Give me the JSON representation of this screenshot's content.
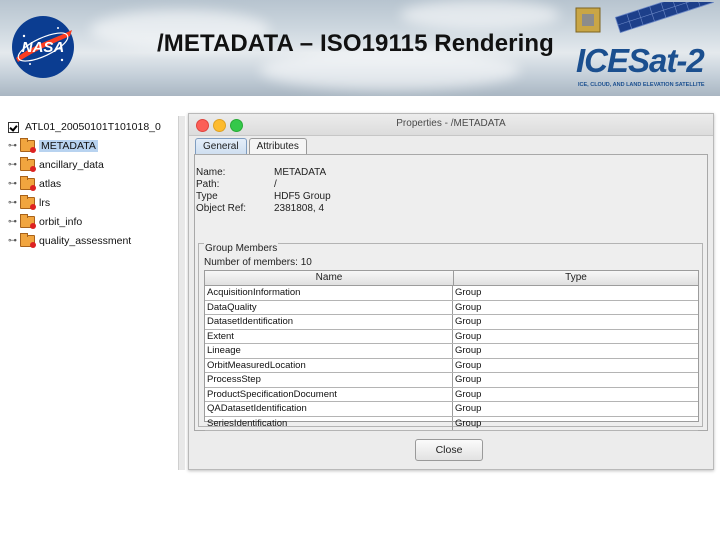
{
  "slide": {
    "title": "/METADATA – ISO19115 Rendering"
  },
  "logos": {
    "nasa_text": "NASA",
    "icesat_text": "ICESat-2",
    "icesat_tagline": "ICE, CLOUD, AND LAND ELEVATION SATELLITE"
  },
  "tree": {
    "root_label": "ATL01_20050101T101018_0",
    "items": [
      {
        "label": "METADATA",
        "selected": true
      },
      {
        "label": "ancillary_data",
        "selected": false
      },
      {
        "label": "atlas",
        "selected": false
      },
      {
        "label": "lrs",
        "selected": false
      },
      {
        "label": "orbit_info",
        "selected": false
      },
      {
        "label": "quality_assessment",
        "selected": false
      }
    ]
  },
  "window": {
    "title": "Properties - /METADATA",
    "tabs": [
      {
        "label": "General",
        "active": true
      },
      {
        "label": "Attributes",
        "active": false
      }
    ],
    "info": [
      {
        "key": "Name:",
        "value": "METADATA"
      },
      {
        "key": "Path:",
        "value": "/"
      },
      {
        "key": "Type",
        "value": "HDF5 Group"
      },
      {
        "key": "Object Ref:",
        "value": "2381808, 4"
      }
    ],
    "group_members": {
      "title": "Group Members",
      "count_label": "Number of members: 10",
      "columns": [
        "Name",
        "Type"
      ],
      "rows": [
        [
          "AcquisitionInformation",
          "Group"
        ],
        [
          "DataQuality",
          "Group"
        ],
        [
          "DatasetIdentification",
          "Group"
        ],
        [
          "Extent",
          "Group"
        ],
        [
          "Lineage",
          "Group"
        ],
        [
          "OrbitMeasuredLocation",
          "Group"
        ],
        [
          "ProcessStep",
          "Group"
        ],
        [
          "ProductSpecificationDocument",
          "Group"
        ],
        [
          "QADatasetIdentification",
          "Group"
        ],
        [
          "SeriesIdentification",
          "Group"
        ]
      ]
    },
    "close_label": "Close"
  },
  "colors": {
    "selection": "#b8d3f0",
    "folder": "#f1a53f",
    "icesat_blue": "#1b4f8f",
    "nasa_blue": "#0b3d91",
    "nasa_red": "#fc3d21"
  }
}
